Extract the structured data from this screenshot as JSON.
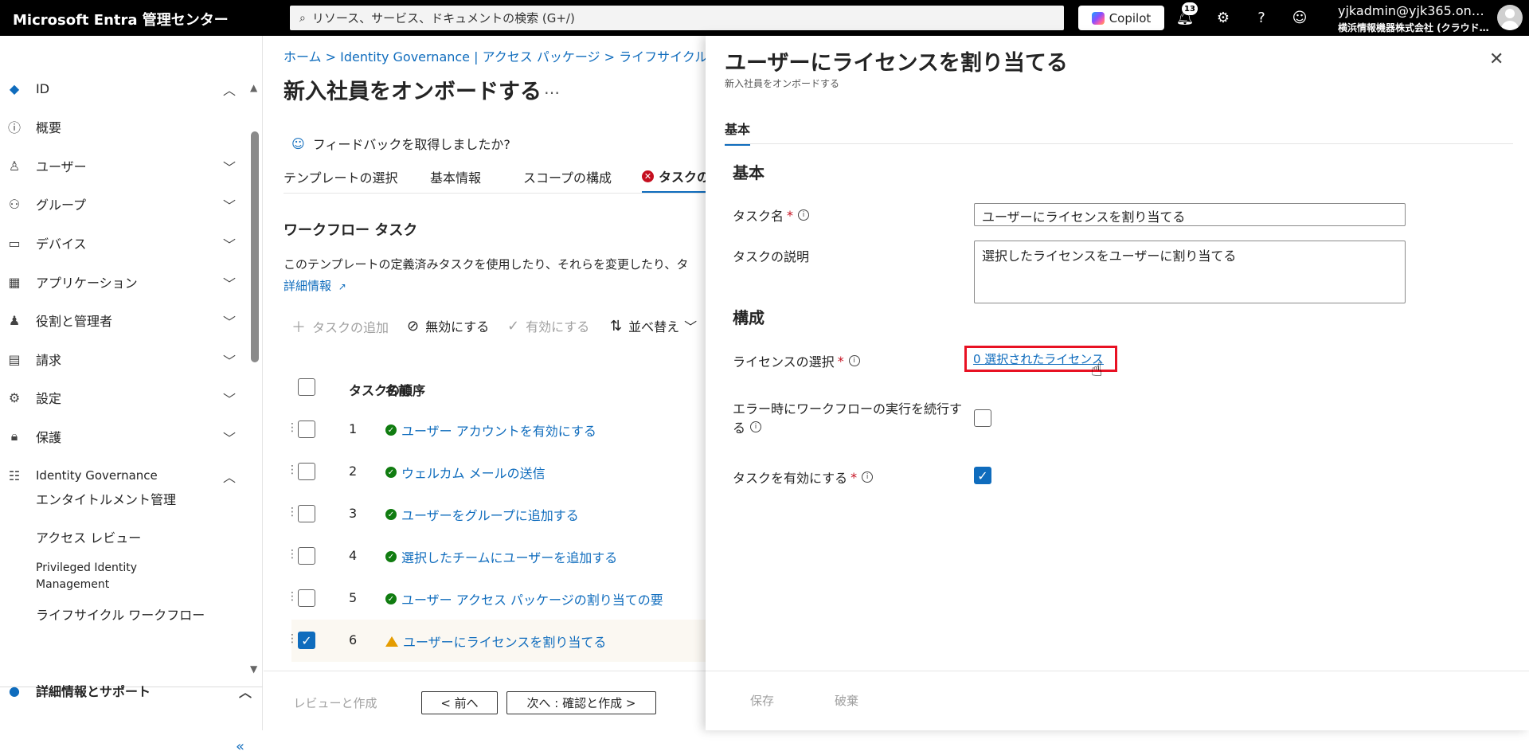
{
  "topbar": {
    "app_title": "Microsoft Entra 管理センター",
    "search_placeholder": "リソース、サービス、ドキュメントの検索 (G+/)",
    "copilot_label": "Copilot",
    "notification_count": "13",
    "account_name": "yjkadmin@yjk365.on…",
    "account_org": "横浜情報機器株式会社 (クラウド…"
  },
  "leftnav": {
    "items": [
      {
        "label": "ID",
        "icon": "identity-icon"
      },
      {
        "label": "概要",
        "icon": "info-icon"
      },
      {
        "label": "ユーザー",
        "icon": "user-icon"
      },
      {
        "label": "グループ",
        "icon": "group-icon"
      },
      {
        "label": "デバイス",
        "icon": "device-icon"
      },
      {
        "label": "アプリケーション",
        "icon": "apps-icon"
      },
      {
        "label": "役割と管理者",
        "icon": "roles-icon"
      },
      {
        "label": "請求",
        "icon": "billing-icon"
      },
      {
        "label": "設定",
        "icon": "gear-icon"
      },
      {
        "label": "保護",
        "icon": "lock-icon"
      },
      {
        "label": "Identity Governance",
        "icon": "governance-icon"
      }
    ],
    "sub_items": [
      "エンタイトルメント管理",
      "アクセス レビュー",
      "Privileged Identity Management",
      "ライフサイクル ワークフロー"
    ],
    "bottom_section": "詳細情報とサポート"
  },
  "main": {
    "breadcrumb": "ホーム > Identity Governance | アクセス パッケージ > ライフサイクル ワーク",
    "title": "新入社員をオンボードする",
    "more": "…",
    "feedback": "フィードバックを取得しましたか?",
    "tabs": [
      "テンプレートの選択",
      "基本情報",
      "スコープの構成",
      "タスクの確"
    ],
    "section_title": "ワークフロー タスク",
    "section_desc": "このテンプレートの定義済みタスクを使用したり、それらを変更したり、タ",
    "learn_more": "詳細情報",
    "toolbar": {
      "add": "タスクの追加",
      "disable": "無効にする",
      "enable": "有効にする",
      "sort": "並べ替え"
    },
    "table": {
      "headers": [
        "タスクの順序",
        "名前"
      ],
      "rows": [
        {
          "order": "1",
          "name": "ユーザー アカウントを有効にする",
          "status": "ok",
          "checked": false
        },
        {
          "order": "2",
          "name": "ウェルカム メールの送信",
          "status": "ok",
          "checked": false
        },
        {
          "order": "3",
          "name": "ユーザーをグループに追加する",
          "status": "ok",
          "checked": false
        },
        {
          "order": "4",
          "name": "選択したチームにユーザーを追加する",
          "status": "ok",
          "checked": false
        },
        {
          "order": "5",
          "name": "ユーザー アクセス パッケージの割り当ての要",
          "status": "ok",
          "checked": false
        },
        {
          "order": "6",
          "name": "ユーザーにライセンスを割り当てる",
          "status": "warning",
          "checked": true
        }
      ]
    },
    "footer": {
      "review_create": "レビューと作成",
      "prev": "< 前へ",
      "next": "次へ : 確認と作成 >"
    }
  },
  "flyout": {
    "title": "ユーザーにライセンスを割り当てる",
    "subtitle": "新入社員をオンボードする",
    "tab": "基本",
    "section_basic": "基本",
    "task_name_label": "タスク名",
    "task_name_value": "ユーザーにライセンスを割り当てる",
    "task_desc_label": "タスクの説明",
    "task_desc_value": "選択したライセンスをユーザーに割り当てる",
    "section_config": "構成",
    "license_label": "ライセンスの選択",
    "license_link": "0 選択されたライセンス",
    "continue_label_line1": "エラー時にワークフローの実行を続行す",
    "continue_label_line2": "る",
    "continue_checked": false,
    "enable_label": "タスクを有効にする",
    "enable_checked": true,
    "save": "保存",
    "discard": "破棄"
  },
  "colors": {
    "accent": "#0f6cbd",
    "highlight_border": "#e81123",
    "ok": "#107c10",
    "warning": "#e59c00"
  }
}
